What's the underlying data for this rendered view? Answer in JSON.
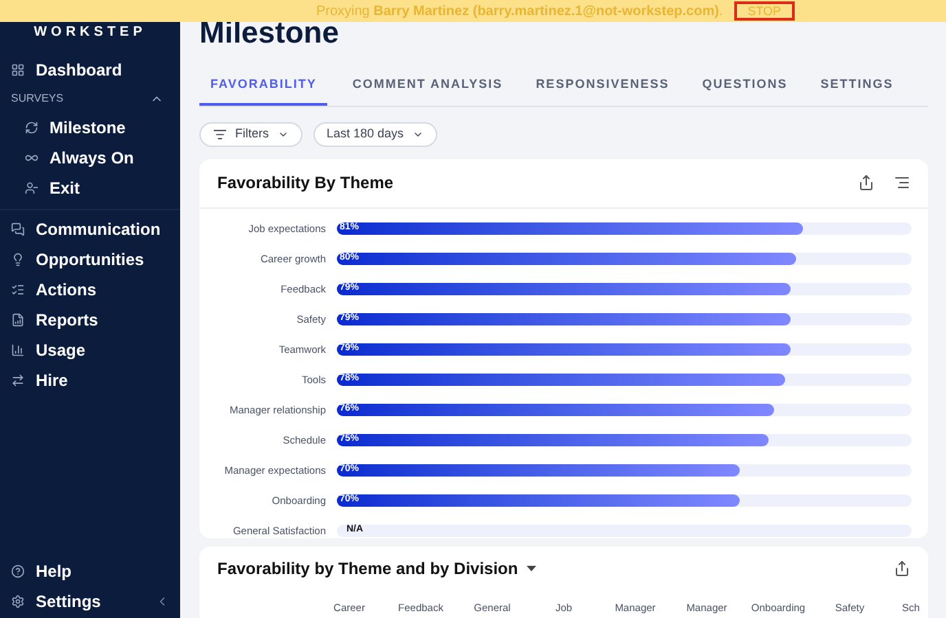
{
  "banner": {
    "text": "Proxying **Barry Martinez (barry.martinez.1@not-workstep.com)**.",
    "stop": "STOP"
  },
  "sidebar": {
    "logo": "WORKSTEP",
    "items": [
      {
        "label": "Dashboard"
      }
    ],
    "section": {
      "label": "SURVEYS",
      "expanded": true,
      "children": [
        {
          "label": "Milestone"
        },
        {
          "label": "Always On"
        },
        {
          "label": "Exit"
        }
      ]
    },
    "items2": [
      {
        "label": "Communication"
      },
      {
        "label": "Opportunities"
      },
      {
        "label": "Actions"
      },
      {
        "label": "Reports"
      },
      {
        "label": "Usage"
      },
      {
        "label": "Hire"
      }
    ],
    "bottom": [
      {
        "label": "Help"
      },
      {
        "label": "Settings"
      }
    ]
  },
  "page_title": "Milestone",
  "tabs": [
    {
      "label": "FAVORABILITY",
      "selected": true
    },
    {
      "label": "COMMENT ANALYSIS",
      "selected": false
    },
    {
      "label": "RESPONSIVENESS",
      "selected": false
    },
    {
      "label": "QUESTIONS",
      "selected": false
    },
    {
      "label": "SETTINGS",
      "selected": false
    }
  ],
  "filters": [
    {
      "label": "Filters"
    },
    {
      "label": "Last 180 days"
    }
  ],
  "theme_card": {
    "title": "Favorability By Theme",
    "rows": [
      {
        "label": "Job expectations",
        "value": "81%",
        "level": 0.81
      },
      {
        "label": "Career growth",
        "value": "80%",
        "level": 0.8
      },
      {
        "label": "Feedback",
        "value": "79%",
        "level": 0.79
      },
      {
        "label": "Safety",
        "value": "79%",
        "level": 0.79
      },
      {
        "label": "Teamwork",
        "value": "79%",
        "level": 0.79
      },
      {
        "label": "Tools",
        "value": "78%",
        "level": 0.78
      },
      {
        "label": "Manager relationship",
        "value": "76%",
        "level": 0.76
      },
      {
        "label": "Schedule",
        "value": "75%",
        "level": 0.75
      },
      {
        "label": "Manager expectations",
        "value": "70%",
        "level": 0.7
      },
      {
        "label": "Onboarding",
        "value": "70%",
        "level": 0.7
      },
      {
        "label": "General Satisfaction",
        "value": "N/A"
      }
    ]
  },
  "division_card": {
    "title": "Favorability by Theme and by Division",
    "columns": [
      "Career",
      "Feedback",
      "General",
      "Job",
      "Manager",
      "Manager",
      "Onboarding",
      "Safety",
      "Sch"
    ]
  }
}
